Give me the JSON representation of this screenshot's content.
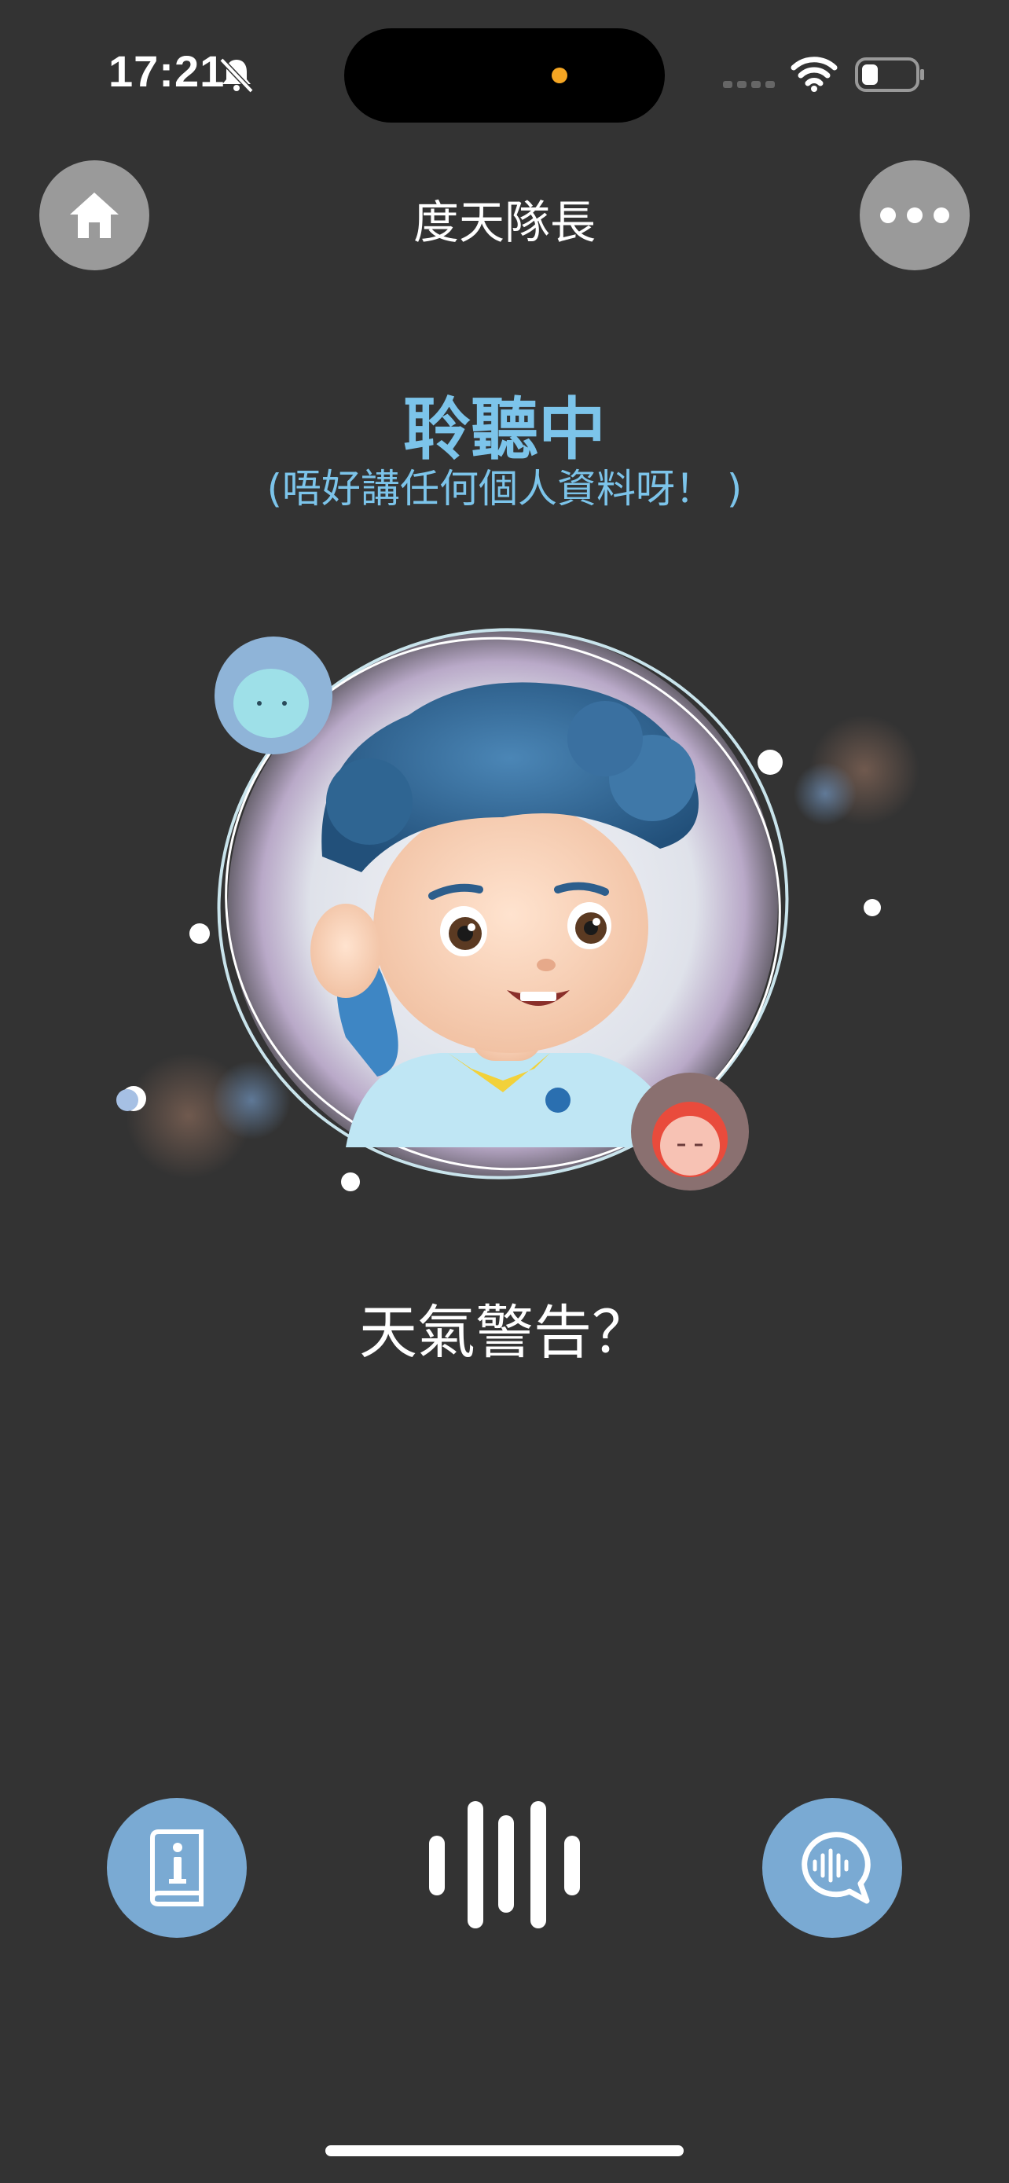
{
  "status_bar": {
    "time": "17:21",
    "icons": [
      "bell-slash-icon",
      "signal-icon",
      "wifi-icon",
      "battery-icon"
    ]
  },
  "header": {
    "title": "度天隊長",
    "left_icon": "home-icon",
    "right_icon": "more-icon"
  },
  "listening": {
    "heading": "聆聽中",
    "subheading": "(唔好講任何個人資料呀！ )"
  },
  "recognized_text": "天氣警告？",
  "controls": {
    "left_icon": "info-book-icon",
    "center_icon": "sound-wave-icon",
    "right_icon": "voice-chat-icon"
  },
  "colors": {
    "background": "#333333",
    "accent": "#7cc4ea",
    "button": "#7aaad3",
    "header_button": "#9a9a9a"
  }
}
